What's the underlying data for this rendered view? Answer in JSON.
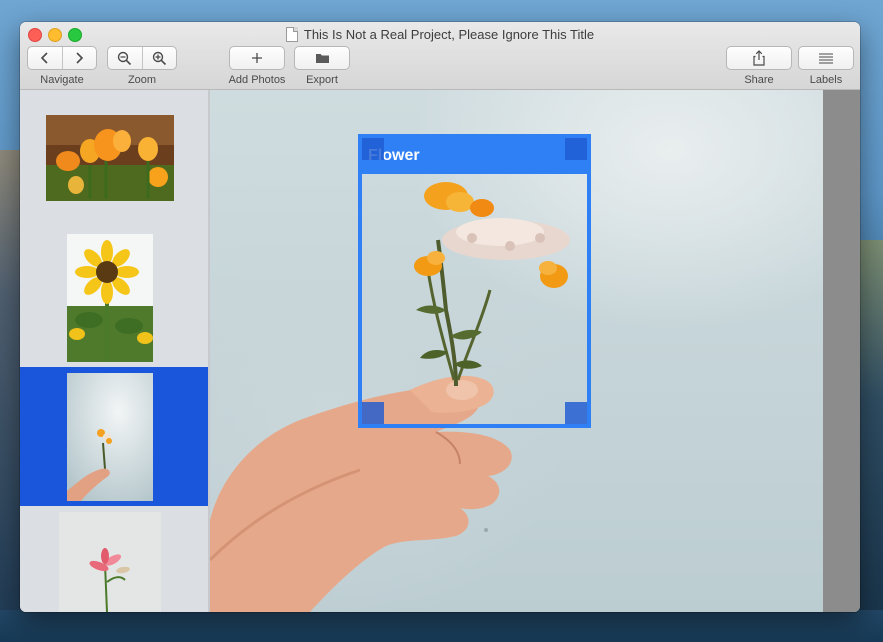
{
  "window": {
    "title": "This Is Not a Real Project, Please Ignore This Title"
  },
  "toolbar": {
    "navigate_label": "Navigate",
    "zoom_label": "Zoom",
    "add_photos_label": "Add Photos",
    "export_label": "Export",
    "share_label": "Share",
    "labels_label": "Labels"
  },
  "sidebar": {
    "thumbnails": [
      {
        "subject": "orange tulips",
        "selected": false
      },
      {
        "subject": "sunflower",
        "selected": false
      },
      {
        "subject": "hand holding flower",
        "selected": true
      },
      {
        "subject": "pink flower",
        "selected": false
      }
    ]
  },
  "annotation": {
    "label": "Flower",
    "color": "#2f7ff5"
  },
  "colors": {
    "selection": "#1a56db",
    "box": "#2f7ff5"
  }
}
